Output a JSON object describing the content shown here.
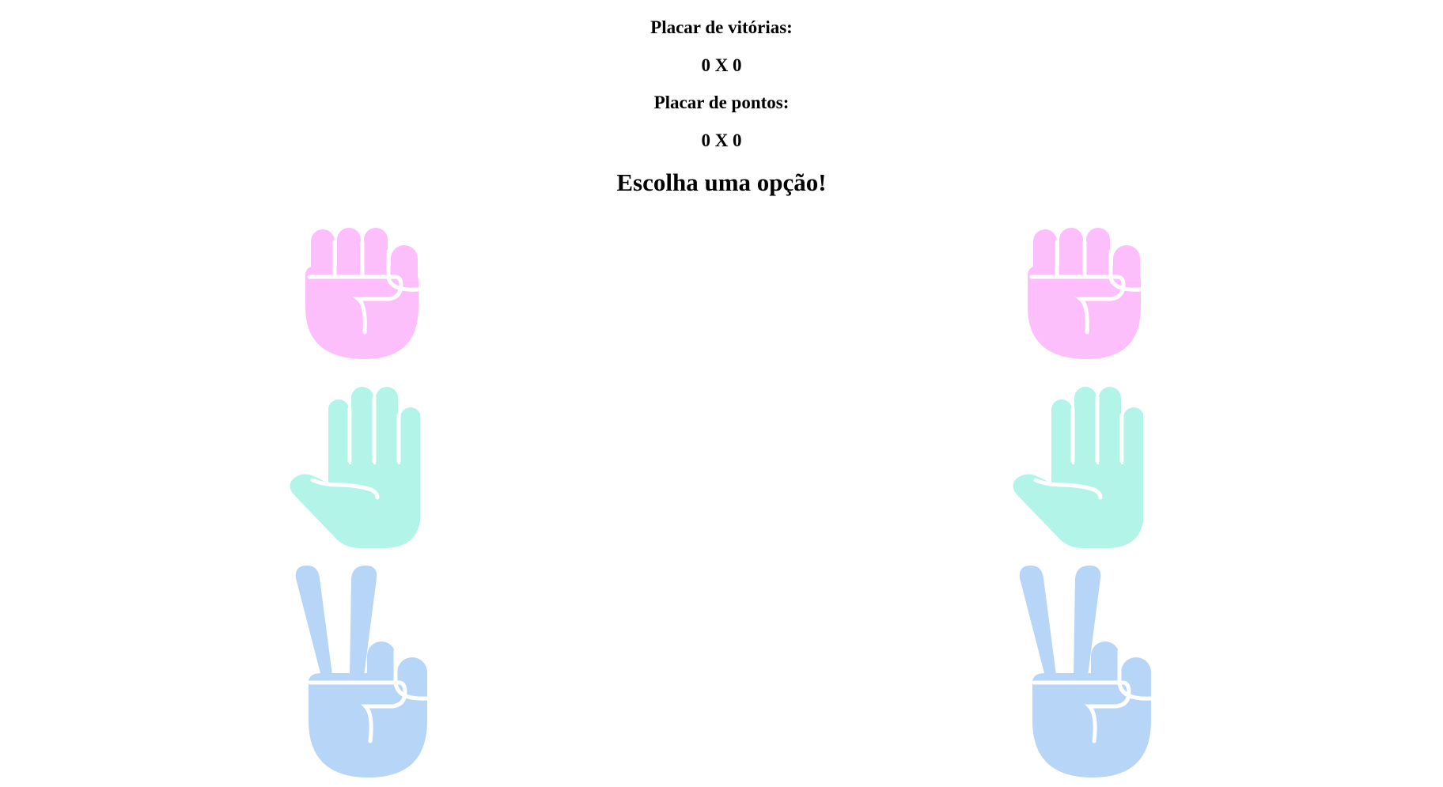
{
  "scoreboard": {
    "wins_title": "Placar de vitórias:",
    "wins_score": "0 X 0",
    "points_title": "Placar de pontos:",
    "points_score": "0 X 0"
  },
  "prompt": "Escolha uma opção!",
  "colors": {
    "rock": "#fcbffc",
    "paper": "#b3f4e9",
    "scissors": "#b7d6f7",
    "background": "#ffffff",
    "text": "#000000"
  },
  "players": [
    {
      "options": [
        {
          "name": "rock",
          "icon": "rock-fist-icon"
        },
        {
          "name": "paper",
          "icon": "paper-hand-icon"
        },
        {
          "name": "scissors",
          "icon": "scissors-peace-icon"
        }
      ]
    },
    {
      "options": [
        {
          "name": "rock",
          "icon": "rock-fist-icon"
        },
        {
          "name": "paper",
          "icon": "paper-hand-icon"
        },
        {
          "name": "scissors",
          "icon": "scissors-peace-icon"
        }
      ]
    }
  ]
}
